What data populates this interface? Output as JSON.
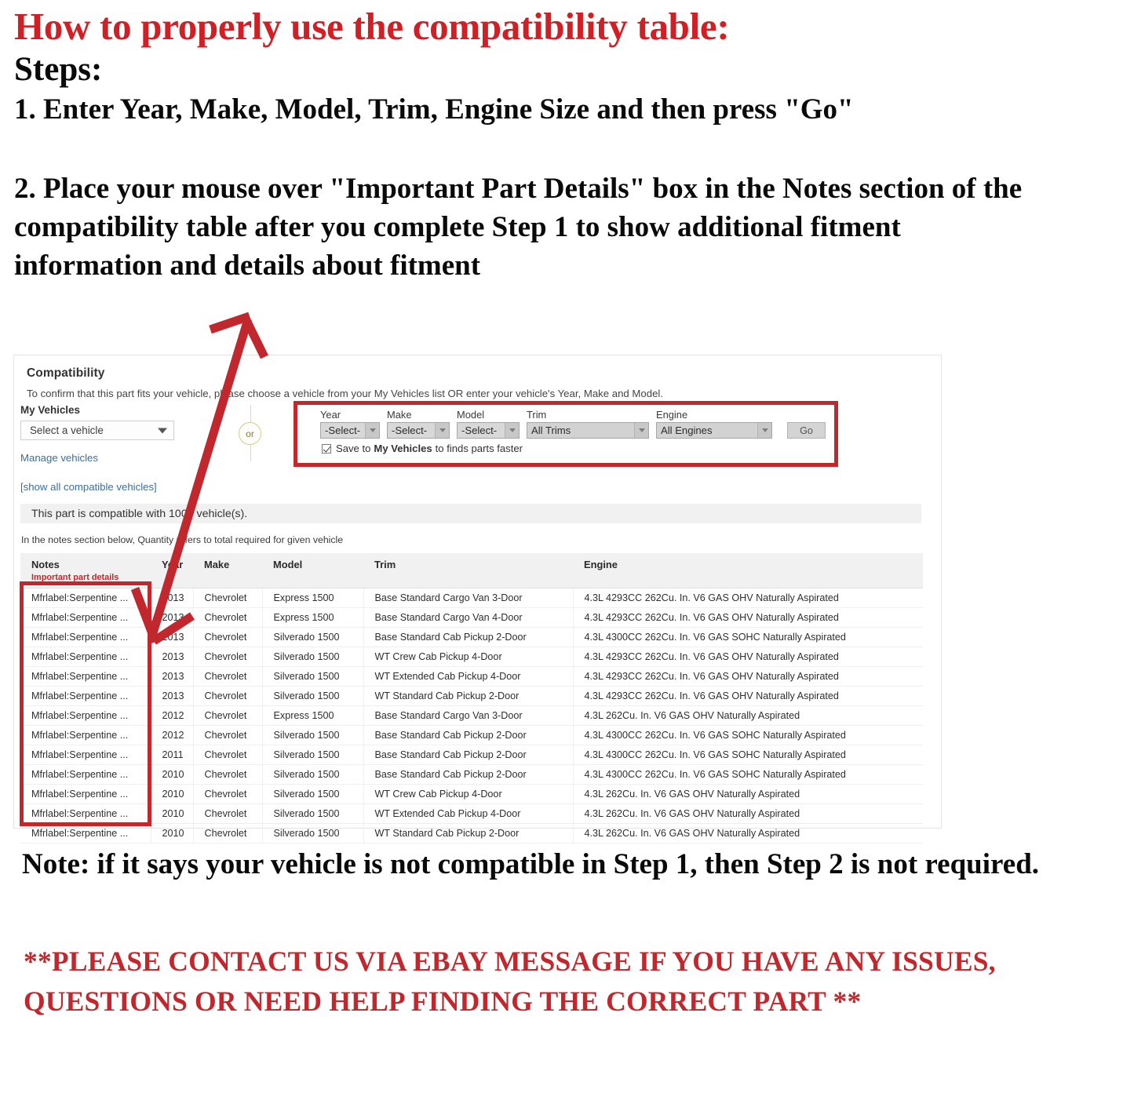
{
  "headline": "How to properly use the compatibility table:",
  "steps_label": "Steps:",
  "step_one": "1. Enter Year, Make, Model, Trim, Engine Size and then press \"Go\"",
  "step_two": "2. Place your mouse over \"Important Part Details\" box in the Notes section of the compatibility table after you complete Step 1 to show additional fitment information and details about fitment",
  "bottom_note": "Note: if it says your vehicle is not compatible in Step 1, then Step 2 is not required.",
  "contact_note": "**PLEASE CONTACT US VIA EBAY MESSAGE IF YOU HAVE ANY ISSUES, QUESTIONS OR NEED HELP FINDING THE CORRECT PART **",
  "colors": {
    "red_accent": "#c0282d",
    "headline_red": "#d11f26",
    "link_blue": "#3c6e9f",
    "header_grey": "#f1f1f1"
  },
  "compat": {
    "title": "Compatibility",
    "subtitle": "To confirm that this part fits your vehicle, please choose a vehicle from your My Vehicles list OR enter your vehicle's Year, Make and Model.",
    "my_vehicles_label": "My Vehicles",
    "vehicle_select_value": "Select a vehicle",
    "manage_vehicles_link": "Manage vehicles",
    "show_all_link": "[show all compatible vehicles]",
    "or_label": "or",
    "fields": [
      {
        "label": "Year",
        "value": "-Select-"
      },
      {
        "label": "Make",
        "value": "-Select-"
      },
      {
        "label": "Model",
        "value": "-Select-"
      },
      {
        "label": "Trim",
        "value": "All Trims"
      },
      {
        "label": "Engine",
        "value": "All Engines"
      }
    ],
    "go_label": "Go",
    "save_prefix": "Save to",
    "save_bold": "My Vehicles",
    "save_suffix": "to finds parts faster",
    "save_checked": true,
    "banner": "This part is compatible with 1000 vehicle(s).",
    "notes_hint": "In the notes section below, Quantity refers to total required for given vehicle"
  },
  "table": {
    "headers": [
      "Notes",
      "Year",
      "Make",
      "Model",
      "Trim",
      "Engine"
    ],
    "notes_sub_header": "Important part details",
    "rows": [
      {
        "notes": "Mfrlabel:Serpentine ...",
        "year": "2013",
        "make": "Chevrolet",
        "model": "Express 1500",
        "trim": "Base Standard Cargo Van 3-Door",
        "engine": "4.3L 4293CC 262Cu. In. V6 GAS OHV Naturally Aspirated"
      },
      {
        "notes": "Mfrlabel:Serpentine ...",
        "year": "2013",
        "make": "Chevrolet",
        "model": "Express 1500",
        "trim": "Base Standard Cargo Van 4-Door",
        "engine": "4.3L 4293CC 262Cu. In. V6 GAS OHV Naturally Aspirated"
      },
      {
        "notes": "Mfrlabel:Serpentine ...",
        "year": "2013",
        "make": "Chevrolet",
        "model": "Silverado 1500",
        "trim": "Base Standard Cab Pickup 2-Door",
        "engine": "4.3L 4300CC 262Cu. In. V6 GAS SOHC Naturally Aspirated"
      },
      {
        "notes": "Mfrlabel:Serpentine ...",
        "year": "2013",
        "make": "Chevrolet",
        "model": "Silverado 1500",
        "trim": "WT Crew Cab Pickup 4-Door",
        "engine": "4.3L 4293CC 262Cu. In. V6 GAS OHV Naturally Aspirated"
      },
      {
        "notes": "Mfrlabel:Serpentine ...",
        "year": "2013",
        "make": "Chevrolet",
        "model": "Silverado 1500",
        "trim": "WT Extended Cab Pickup 4-Door",
        "engine": "4.3L 4293CC 262Cu. In. V6 GAS OHV Naturally Aspirated"
      },
      {
        "notes": "Mfrlabel:Serpentine ...",
        "year": "2013",
        "make": "Chevrolet",
        "model": "Silverado 1500",
        "trim": "WT Standard Cab Pickup 2-Door",
        "engine": "4.3L 4293CC 262Cu. In. V6 GAS OHV Naturally Aspirated"
      },
      {
        "notes": "Mfrlabel:Serpentine ...",
        "year": "2012",
        "make": "Chevrolet",
        "model": "Express 1500",
        "trim": "Base Standard Cargo Van 3-Door",
        "engine": "4.3L 262Cu. In. V6 GAS OHV Naturally Aspirated"
      },
      {
        "notes": "Mfrlabel:Serpentine ...",
        "year": "2012",
        "make": "Chevrolet",
        "model": "Silverado 1500",
        "trim": "Base Standard Cab Pickup 2-Door",
        "engine": "4.3L 4300CC 262Cu. In. V6 GAS SOHC Naturally Aspirated"
      },
      {
        "notes": "Mfrlabel:Serpentine ...",
        "year": "2011",
        "make": "Chevrolet",
        "model": "Silverado 1500",
        "trim": "Base Standard Cab Pickup 2-Door",
        "engine": "4.3L 4300CC 262Cu. In. V6 GAS SOHC Naturally Aspirated"
      },
      {
        "notes": "Mfrlabel:Serpentine ...",
        "year": "2010",
        "make": "Chevrolet",
        "model": "Silverado 1500",
        "trim": "Base Standard Cab Pickup 2-Door",
        "engine": "4.3L 4300CC 262Cu. In. V6 GAS SOHC Naturally Aspirated"
      },
      {
        "notes": "Mfrlabel:Serpentine ...",
        "year": "2010",
        "make": "Chevrolet",
        "model": "Silverado 1500",
        "trim": "WT Crew Cab Pickup 4-Door",
        "engine": "4.3L 262Cu. In. V6 GAS OHV Naturally Aspirated"
      },
      {
        "notes": "Mfrlabel:Serpentine ...",
        "year": "2010",
        "make": "Chevrolet",
        "model": "Silverado 1500",
        "trim": "WT Extended Cab Pickup 4-Door",
        "engine": "4.3L 262Cu. In. V6 GAS OHV Naturally Aspirated"
      },
      {
        "notes": "Mfrlabel:Serpentine ...",
        "year": "2010",
        "make": "Chevrolet",
        "model": "Silverado 1500",
        "trim": "WT Standard Cab Pickup 2-Door",
        "engine": "4.3L 262Cu. In. V6 GAS OHV Naturally Aspirated"
      }
    ]
  }
}
